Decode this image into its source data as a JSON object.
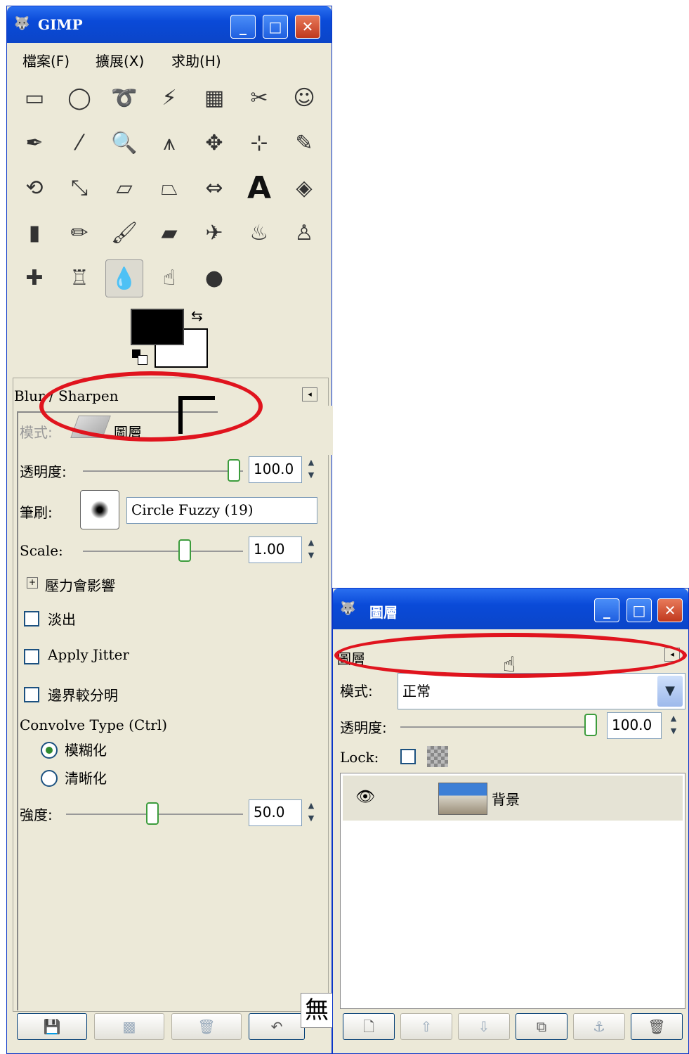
{
  "toolbox": {
    "title": "GIMP",
    "menu": [
      "檔案(F)",
      "擴展(X)",
      "求助(H)"
    ],
    "tools": [
      {
        "name": "rect-select-icon",
        "glyph": "▭"
      },
      {
        "name": "ellipse-select-icon",
        "glyph": "◯"
      },
      {
        "name": "free-select-icon",
        "glyph": "➰"
      },
      {
        "name": "fuzzy-select-icon",
        "glyph": "⚡"
      },
      {
        "name": "select-by-color-icon",
        "glyph": "▦"
      },
      {
        "name": "scissors-icon",
        "glyph": "✂"
      },
      {
        "name": "foreground-select-icon",
        "glyph": "☺"
      },
      {
        "name": "paths-icon",
        "glyph": "✒"
      },
      {
        "name": "color-picker-icon",
        "glyph": "⁄"
      },
      {
        "name": "zoom-icon",
        "glyph": "🔍"
      },
      {
        "name": "measure-icon",
        "glyph": "⩚"
      },
      {
        "name": "move-icon",
        "glyph": "✥"
      },
      {
        "name": "align-icon",
        "glyph": "⊹"
      },
      {
        "name": "crop-icon",
        "glyph": "✎"
      },
      {
        "name": "rotate-icon",
        "glyph": "⟲"
      },
      {
        "name": "scale-icon",
        "glyph": "⤡"
      },
      {
        "name": "shear-icon",
        "glyph": "▱"
      },
      {
        "name": "perspective-icon",
        "glyph": "⏢"
      },
      {
        "name": "flip-icon",
        "glyph": "⇔"
      },
      {
        "name": "text-icon",
        "glyph": "A"
      },
      {
        "name": "bucket-fill-icon",
        "glyph": "◈"
      },
      {
        "name": "blend-icon",
        "glyph": "▮"
      },
      {
        "name": "pencil-icon",
        "glyph": "✏"
      },
      {
        "name": "paintbrush-icon",
        "glyph": "🖌"
      },
      {
        "name": "eraser-icon",
        "glyph": "▰"
      },
      {
        "name": "airbrush-icon",
        "glyph": "✈"
      },
      {
        "name": "ink-icon",
        "glyph": "♨"
      },
      {
        "name": "clone-icon",
        "glyph": "♙"
      },
      {
        "name": "heal-icon",
        "glyph": "✚"
      },
      {
        "name": "perspective-clone-icon",
        "glyph": "♖"
      },
      {
        "name": "blur-sharpen-icon",
        "glyph": "💧"
      },
      {
        "name": "smudge-icon",
        "glyph": "☝"
      },
      {
        "name": "dodge-burn-icon",
        "glyph": "●"
      }
    ],
    "active_tool_index": 30,
    "colors": {
      "foreground": "#000000",
      "background": "#ffffff"
    }
  },
  "tool_options": {
    "title": "Blur / Sharpen",
    "mode_label": "模式:",
    "mode_value": "圖層",
    "opacity_label": "透明度:",
    "opacity_value": "100.0",
    "opacity_fraction": 1.0,
    "brush_label": "筆刷:",
    "brush_value": "Circle Fuzzy (19)",
    "scale_label": "Scale:",
    "scale_value": "1.00",
    "scale_fraction": 0.5,
    "pressure_label": "壓力會影響",
    "fade_label": "淡出",
    "jitter_label": "Apply Jitter",
    "hard_edge_label": "邊界較分明",
    "convolve_label": "Convolve Type  (Ctrl)",
    "blur_label": "模糊化",
    "sharpen_label": "清晰化",
    "convolve_selected": "模糊化",
    "rate_label": "強度:",
    "rate_value": "50.0",
    "rate_fraction": 0.5
  },
  "ime_badge": "無",
  "layers": {
    "title": "圖層",
    "tab_label": "圖層",
    "mode_label": "模式:",
    "mode_value": "正常",
    "opacity_label": "透明度:",
    "opacity_value": "100.0",
    "lock_label": "Lock:",
    "items": [
      {
        "name": "背景",
        "visible": true
      }
    ]
  },
  "highlight_color": "#e0141e"
}
